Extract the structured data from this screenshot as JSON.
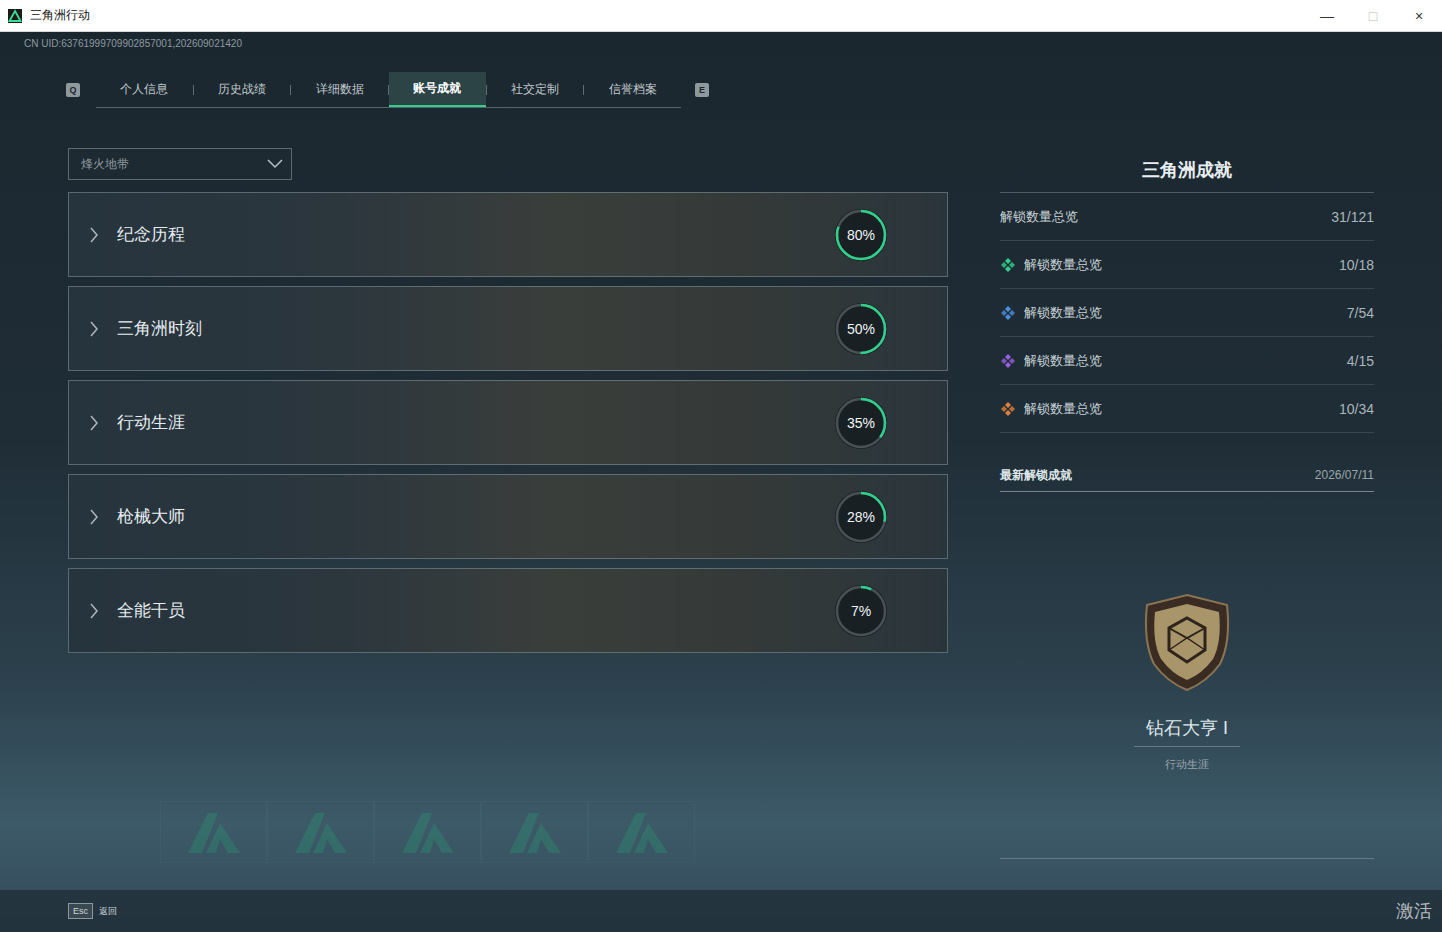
{
  "window": {
    "title": "三角洲行动",
    "controls": [
      {
        "glyph": "—",
        "disabled": false
      },
      {
        "glyph": "□",
        "disabled": true
      },
      {
        "glyph": "×",
        "disabled": false
      }
    ]
  },
  "uid": "CN UID:63761999709902857001,202609021420",
  "tabs": {
    "prev_key": "Q",
    "next_key": "E",
    "items": [
      {
        "label": "个人信息",
        "selected": false
      },
      {
        "label": "历史战绩",
        "selected": false
      },
      {
        "label": "详细数据",
        "selected": false
      },
      {
        "label": "账号成就",
        "selected": true
      },
      {
        "label": "社交定制",
        "selected": false
      },
      {
        "label": "信誉档案",
        "selected": false
      }
    ]
  },
  "mode_select": {
    "value": "烽火地带"
  },
  "categories": [
    {
      "name": "纪念历程",
      "percent": "80%",
      "level": 0.8
    },
    {
      "name": "三角洲时刻",
      "percent": "50%",
      "level": 0.5
    },
    {
      "name": "行动生涯",
      "percent": "35%",
      "level": 0.35
    },
    {
      "name": "枪械大师",
      "percent": "28%",
      "level": 0.28
    },
    {
      "name": "全能干员",
      "percent": "7%",
      "level": 0.07
    }
  ],
  "summary": {
    "title": "三角洲成就",
    "total": {
      "label": "解锁数量总览",
      "value": "31/121"
    },
    "rarities": [
      {
        "label": "解锁数量总览",
        "value": "10/18",
        "color": "#2fd18a"
      },
      {
        "label": "解锁数量总览",
        "value": "7/54",
        "color": "#4a8fe0"
      },
      {
        "label": "解锁数量总览",
        "value": "4/15",
        "color": "#9a5fe0"
      },
      {
        "label": "解锁数量总览",
        "value": "10/34",
        "color": "#e0803a"
      }
    ]
  },
  "latest": {
    "label": "最新解锁成就",
    "date": "2026/07/11",
    "name": "钻石大亨 I",
    "category": "行动生涯"
  },
  "footer": {
    "key": "Esc",
    "action": "返回"
  },
  "watermark": "激活"
}
